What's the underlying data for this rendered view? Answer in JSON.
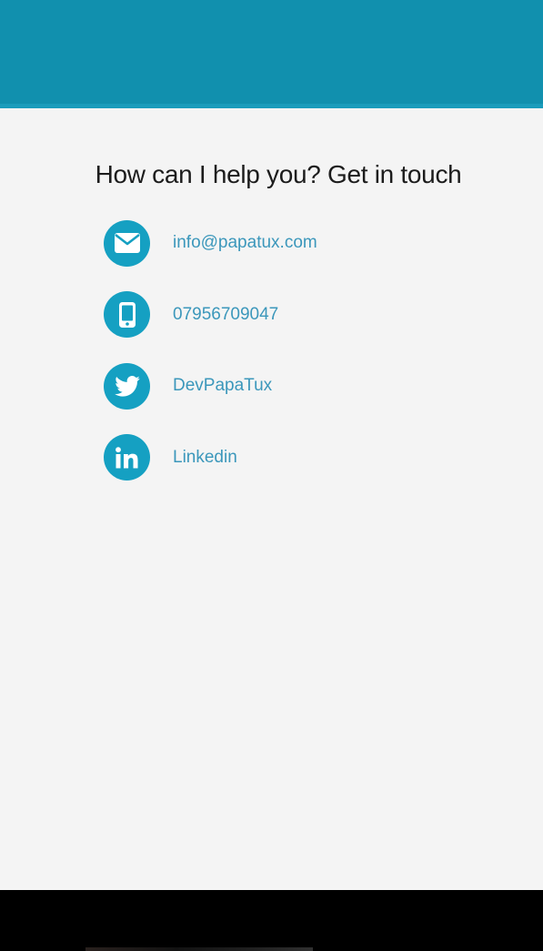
{
  "contact": {
    "title": "How can I help you? Get in touch",
    "items": [
      {
        "icon": "envelope-icon",
        "label": "info@papatux.com"
      },
      {
        "icon": "mobile-phone-icon",
        "label": "07956709047"
      },
      {
        "icon": "twitter-icon",
        "label": "DevPapaTux"
      },
      {
        "icon": "linkedin-icon",
        "label": "Linkedin"
      }
    ]
  },
  "colors": {
    "header": "#1190ae",
    "background": "#f4f4f4",
    "icon_circle": "#15a0c2",
    "link": "#3b97bb",
    "title": "#1c1c1c",
    "footer": "#000000"
  }
}
